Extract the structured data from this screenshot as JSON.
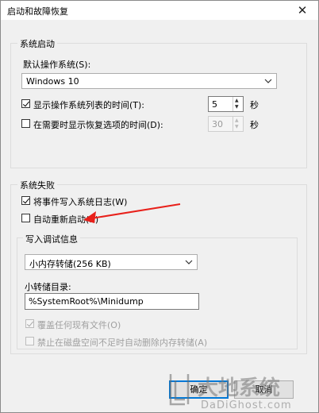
{
  "window": {
    "title": "启动和故障恢复",
    "close_glyph": "✕"
  },
  "system_startup": {
    "group_label": "系统启动",
    "default_os_label": "默认操作系统(S):",
    "default_os_value": "Windows 10",
    "show_os_list": {
      "label": "显示操作系统列表的时间(T):",
      "checked": true,
      "value": "5",
      "unit": "秒"
    },
    "show_recovery": {
      "label": "在需要时显示恢复选项的时间(D):",
      "checked": false,
      "value": "30",
      "unit": "秒"
    }
  },
  "system_failure": {
    "group_label": "系统失败",
    "write_event_log": {
      "label": "将事件写入系统日志(W)",
      "checked": true
    },
    "auto_restart": {
      "label": "自动重新启动(R)",
      "checked": false
    },
    "debug_info": {
      "group_label": "写入调试信息",
      "dump_type": "小内存转储(256 KB)",
      "dump_dir_label": "小转储目录:",
      "dump_dir_value": "%SystemRoot%\\Minidump",
      "overwrite": {
        "label": "覆盖任何现有文件(O)",
        "checked": true,
        "disabled": true
      },
      "disable_low_disk": {
        "label": "禁止在磁盘空间不足时自动删除内存转储(A)",
        "checked": false,
        "disabled": true
      }
    }
  },
  "buttons": {
    "ok": "确定",
    "cancel": "取消"
  },
  "annotation": {
    "arrow_color": "#e8201a"
  },
  "watermark": {
    "text_main": "大地系统",
    "text_sub": "DaDiGhost.com"
  }
}
